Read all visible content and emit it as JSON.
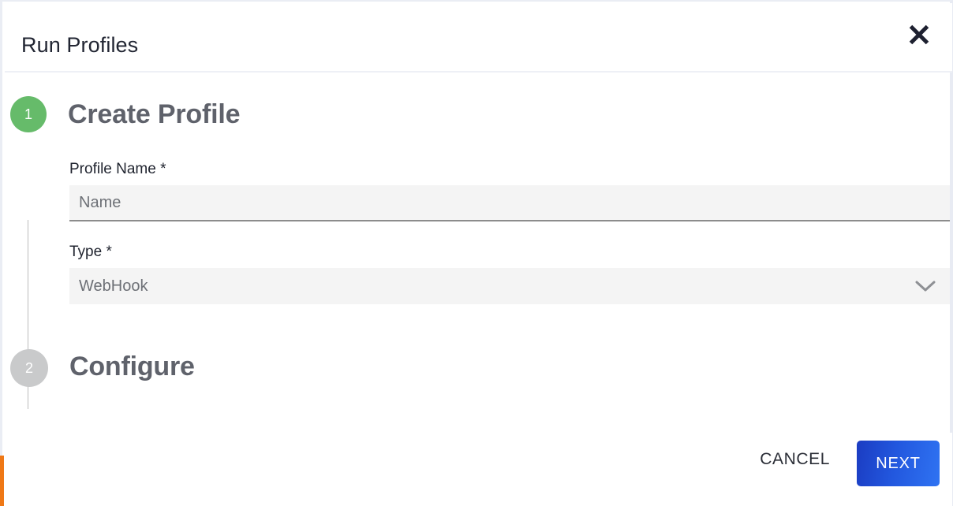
{
  "dialog": {
    "title": "Run Profiles",
    "close_icon": "close-icon",
    "accent_color": "#ef7816"
  },
  "stepper": {
    "steps": [
      {
        "number": "1",
        "label": "Create Profile",
        "state": "active",
        "color": "#66bb6a"
      },
      {
        "number": "2",
        "label": "Configure",
        "state": "inactive",
        "color": "#c9cacb"
      }
    ]
  },
  "form": {
    "profile_name": {
      "label": "Profile Name *",
      "placeholder": "Name",
      "value": ""
    },
    "type": {
      "label": "Type *",
      "value": "WebHook",
      "chevron_icon": "chevron-down-icon"
    }
  },
  "footer": {
    "cancel_label": "CANCEL",
    "next_label": "NEXT",
    "next_color": "#2257de"
  }
}
